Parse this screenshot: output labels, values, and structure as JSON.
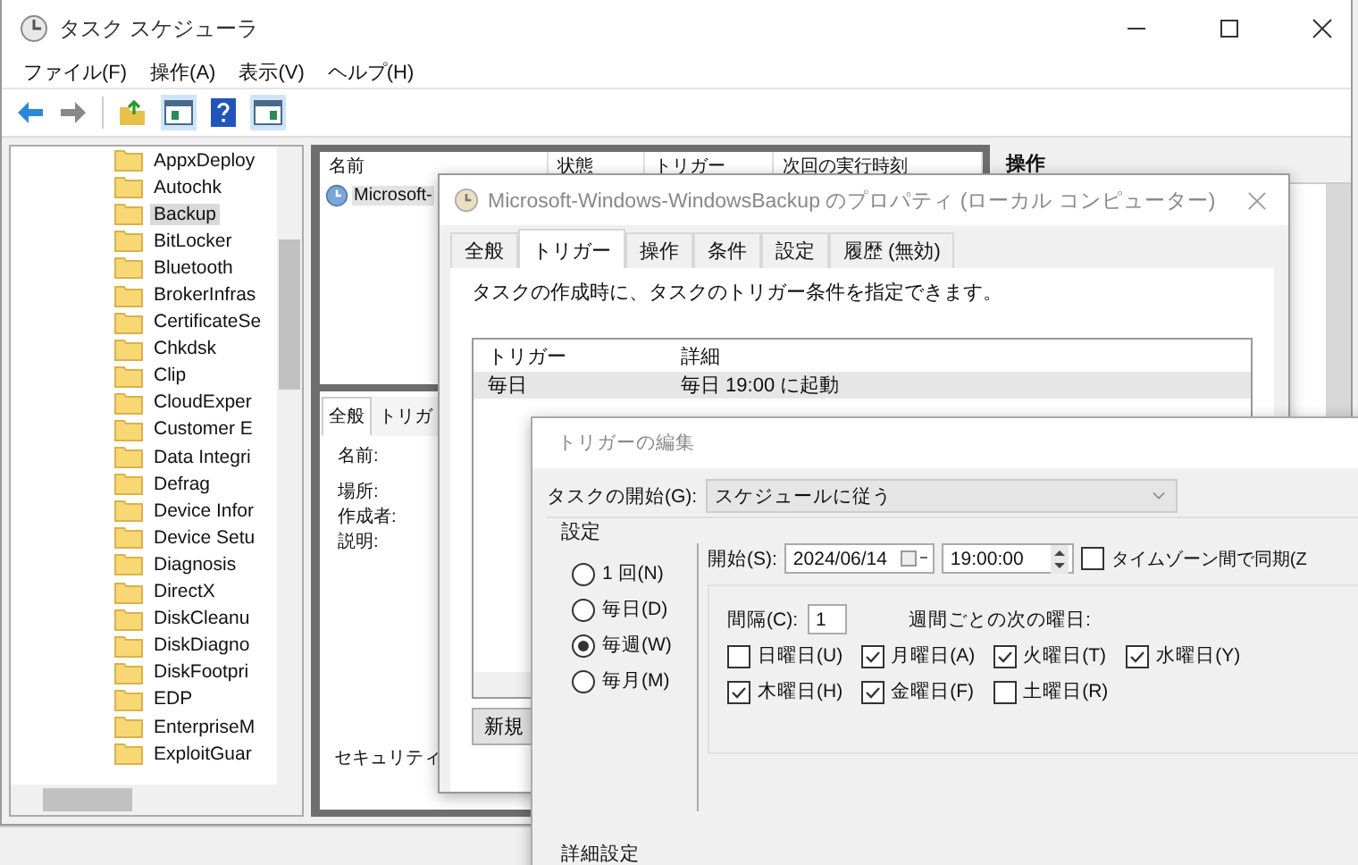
{
  "main_window": {
    "title": "タスク スケジューラ",
    "menu": [
      "ファイル(F)",
      "操作(A)",
      "表示(V)",
      "ヘルプ(H)"
    ]
  },
  "tree": {
    "items": [
      {
        "label": "AppxDeploy",
        "selected": false
      },
      {
        "label": "Autochk",
        "selected": false
      },
      {
        "label": "Backup",
        "selected": true
      },
      {
        "label": "BitLocker",
        "selected": false
      },
      {
        "label": "Bluetooth",
        "selected": false
      },
      {
        "label": "BrokerInfras",
        "selected": false
      },
      {
        "label": "CertificateSe",
        "selected": false
      },
      {
        "label": "Chkdsk",
        "selected": false
      },
      {
        "label": "Clip",
        "selected": false
      },
      {
        "label": "CloudExper",
        "selected": false
      },
      {
        "label": "Customer E",
        "selected": false
      },
      {
        "label": "Data Integri",
        "selected": false
      },
      {
        "label": "Defrag",
        "selected": false
      },
      {
        "label": "Device Infor",
        "selected": false
      },
      {
        "label": "Device Setu",
        "selected": false
      },
      {
        "label": "Diagnosis",
        "selected": false
      },
      {
        "label": "DirectX",
        "selected": false
      },
      {
        "label": "DiskCleanu",
        "selected": false
      },
      {
        "label": "DiskDiagno",
        "selected": false
      },
      {
        "label": "DiskFootpri",
        "selected": false
      },
      {
        "label": "EDP",
        "selected": false
      },
      {
        "label": "EnterpriseM",
        "selected": false
      },
      {
        "label": "ExploitGuar",
        "selected": false
      }
    ]
  },
  "task_list": {
    "columns": [
      "名前",
      "状態",
      "トリガー",
      "次回の実行時刻"
    ],
    "rows": [
      {
        "name": "Microsoft-",
        "selected": true
      }
    ]
  },
  "details": {
    "tabs": [
      {
        "label": "全般",
        "selected": true
      },
      {
        "label": "トリガ",
        "selected": false
      }
    ],
    "fields": [
      "名前:",
      "場所:",
      "作成者:",
      "説明:"
    ],
    "section": "セキュリティ"
  },
  "actions_pane": {
    "title": "操作"
  },
  "properties_dialog": {
    "title": "Microsoft-Windows-WindowsBackup のプロパティ (ローカル コンピューター)",
    "tabs": [
      {
        "label": "全般",
        "selected": false
      },
      {
        "label": "トリガー",
        "selected": true
      },
      {
        "label": "操作",
        "selected": false
      },
      {
        "label": "条件",
        "selected": false
      },
      {
        "label": "設定",
        "selected": false
      },
      {
        "label": "履歴 (無効)",
        "selected": false
      }
    ],
    "description": "タスクの作成時に、タスクのトリガー条件を指定できます。",
    "columns": [
      "トリガー",
      "詳細"
    ],
    "rows": [
      {
        "trigger": "毎日",
        "details": "毎日 19:00 に起動",
        "selected": true
      }
    ],
    "new_button": "新規"
  },
  "trigger_editor": {
    "title": "トリガーの編集",
    "start_label": "タスクの開始(G):",
    "start_value": "スケジュールに従う",
    "settings_label": "設定",
    "schedule": [
      {
        "label": "1 回(N)",
        "selected": false
      },
      {
        "label": "毎日(D)",
        "selected": false
      },
      {
        "label": "毎週(W)",
        "selected": true
      },
      {
        "label": "毎月(M)",
        "selected": false
      }
    ],
    "start": {
      "label": "開始(S):",
      "date": "2024/06/14",
      "time": "19:00:00"
    },
    "sync_timezone": {
      "label": "タイムゾーン間で同期(Z",
      "checked": false
    },
    "interval": {
      "label": "間隔(C):",
      "value": "1",
      "suffix": "週間ごとの次の曜日:"
    },
    "days": [
      {
        "label": "日曜日(U)",
        "checked": false
      },
      {
        "label": "月曜日(A)",
        "checked": true
      },
      {
        "label": "火曜日(T)",
        "checked": true
      },
      {
        "label": "水曜日(Y)",
        "checked": true
      },
      {
        "label": "木曜日(H)",
        "checked": true
      },
      {
        "label": "金曜日(F)",
        "checked": true
      },
      {
        "label": "土曜日(R)",
        "checked": false
      }
    ],
    "advanced_label": "詳細設定"
  }
}
